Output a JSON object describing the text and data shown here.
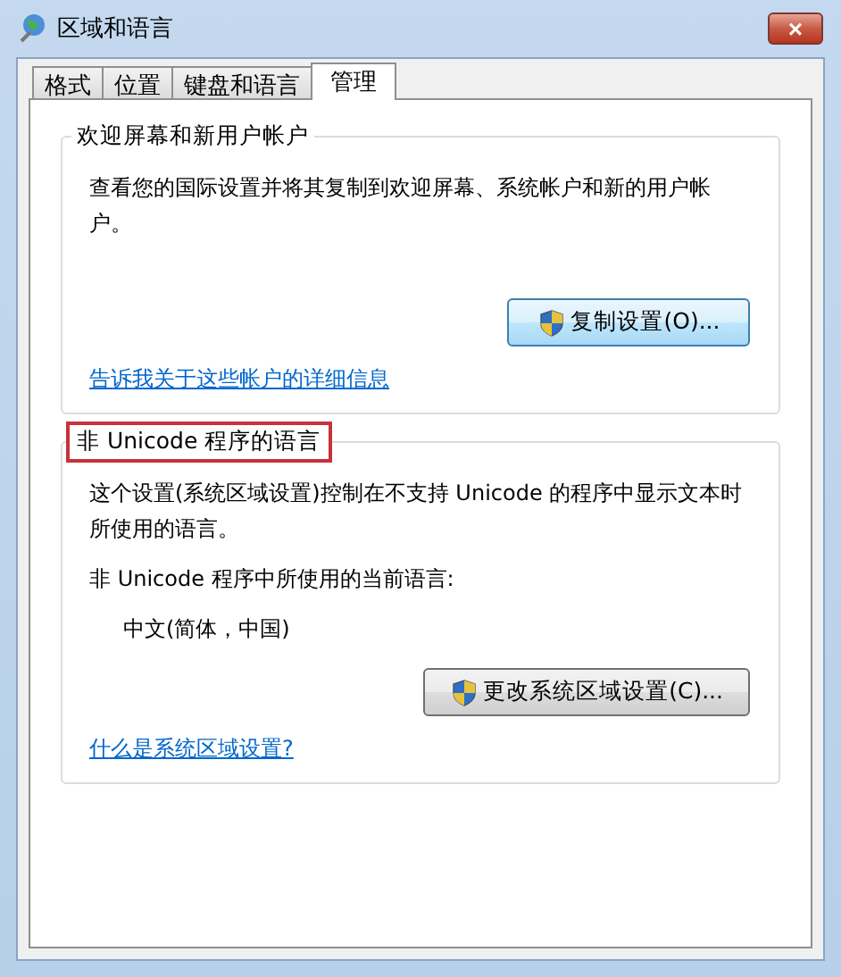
{
  "window": {
    "title": "区域和语言",
    "close": "×"
  },
  "tabs": [
    {
      "label": "格式",
      "selected": false
    },
    {
      "label": "位置",
      "selected": false
    },
    {
      "label": "键盘和语言",
      "selected": false
    },
    {
      "label": "管理",
      "selected": true
    }
  ],
  "groups": [
    {
      "title": "欢迎屏幕和新用户帐户",
      "highlighted": false,
      "paragraphs": [
        {
          "kind": "text",
          "text": "查看您的国际设置并将其复制到欢迎屏幕、系统帐户和新的用户帐户。"
        }
      ],
      "button": {
        "label": "复制设置(O)...",
        "focused": true
      },
      "link": "告诉我关于这些帐户的详细信息"
    },
    {
      "title": "非 Unicode 程序的语言",
      "highlighted": true,
      "paragraphs": [
        {
          "kind": "text",
          "text": "这个设置(系统区域设置)控制在不支持 Unicode 的程序中显示文本时所使用的语言。"
        },
        {
          "kind": "text",
          "text": "非 Unicode 程序中所使用的当前语言:"
        },
        {
          "kind": "value",
          "text": "中文(简体，中国)"
        }
      ],
      "button": {
        "label": "更改系统区域设置(C)...",
        "focused": false
      },
      "link": "什么是系统区域设置?"
    }
  ]
}
